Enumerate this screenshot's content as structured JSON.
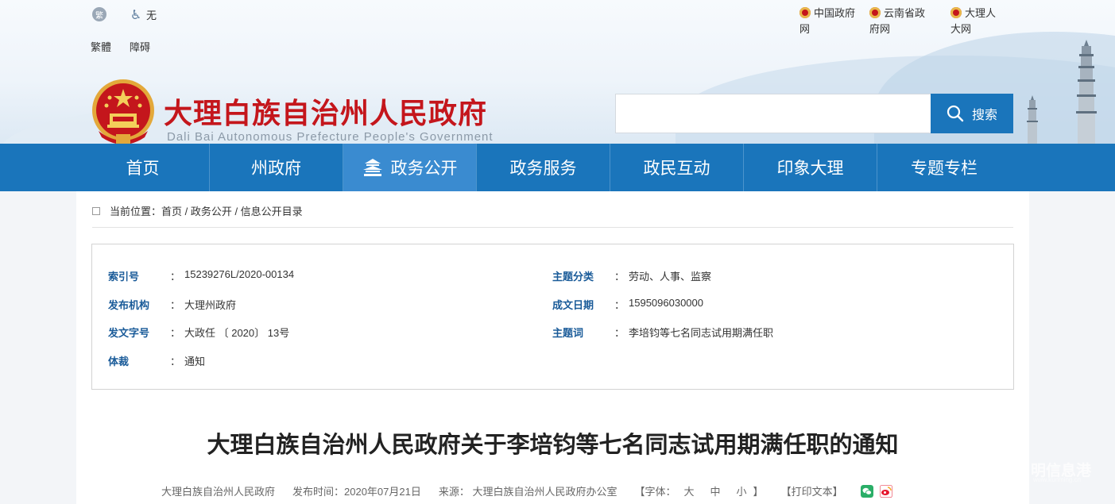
{
  "toolbar": {
    "traditional_label": "繁體",
    "traditional_icon_glyph": "繁",
    "accessibility_label": "障碍",
    "accessibility_status": "无"
  },
  "portals": [
    {
      "label": "中国政府网"
    },
    {
      "label": "云南省政府网"
    },
    {
      "label": "大理人大网"
    }
  ],
  "site": {
    "title": "大理白族自治州人民政府",
    "subtitle": "Dali Bai Autonomous Prefecture People's Government"
  },
  "search": {
    "placeholder": "",
    "button_label": "搜索"
  },
  "nav": {
    "items": [
      {
        "label": "首页"
      },
      {
        "label": "州政府"
      },
      {
        "label": "政务公开"
      },
      {
        "label": "政务服务"
      },
      {
        "label": "政民互动"
      },
      {
        "label": "印象大理"
      },
      {
        "label": "专题专栏"
      }
    ],
    "active_index": 2
  },
  "breadcrumb": {
    "text": "当前位置：首页 / 政务公开 / 信息公开目录"
  },
  "meta": {
    "index_no": {
      "label": "索引号",
      "value": "15239276L/2020-00134"
    },
    "topic_category": {
      "label": "主题分类",
      "value": "劳动、人事、监察"
    },
    "issuer": {
      "label": "发布机构",
      "value": "大理州政府"
    },
    "date_created": {
      "label": "成文日期",
      "value": "1595096030000"
    },
    "doc_no": {
      "label": "发文字号",
      "value": "大政任 〔 2020〕 13号"
    },
    "keywords": {
      "label": "主题词",
      "value": "李培钧等七名同志试用期满任职"
    },
    "genre": {
      "label": "体裁",
      "value": "通知"
    },
    "colon": "："
  },
  "article": {
    "title": "大理白族自治州人民政府关于李培钧等七名同志试用期满任职的通知",
    "author": "大理白族自治州人民政府",
    "publish_time": "发布时间：2020年07月21日",
    "source": "来源： 大理白族自治州人民政府办公室",
    "font_size_label": "【字体：",
    "font_large": "大",
    "font_medium": "中",
    "font_small": "小",
    "font_close": "】",
    "print_label": "【打印文本】"
  },
  "watermark": {
    "text": "明信息港",
    "sub": "www.kunming.cn"
  },
  "colors": {
    "brand_blue": "#1a75bb",
    "title_red": "#c4161c",
    "label_blue": "#1a5b99"
  }
}
